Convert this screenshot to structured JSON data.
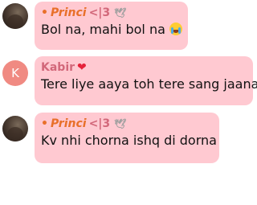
{
  "messages": [
    {
      "sender": "Princi",
      "sender_prefix": "•",
      "sender_suffix": "<|3",
      "sender_icon": "dove-icon",
      "avatar": "photo",
      "text": "Bol na, mahi bol na",
      "emoji": "crying-face-emoji"
    },
    {
      "sender": "Kabir",
      "sender_icon": "heart-icon",
      "avatar_letter": "K",
      "avatar_color": "#f08a82",
      "text": "Tere liye aaya toh tere sang jaana"
    },
    {
      "sender": "Princi",
      "sender_prefix": "•",
      "sender_suffix": "<|3",
      "sender_icon": "dove-icon",
      "avatar": "photo",
      "text": "Kv nhi chorna ishq di dorna"
    }
  ],
  "colors": {
    "bubble": "#ffc9d1",
    "princi_name": "#e8702a",
    "kabir_name": "#d2687a",
    "heart": "#e5223a"
  }
}
